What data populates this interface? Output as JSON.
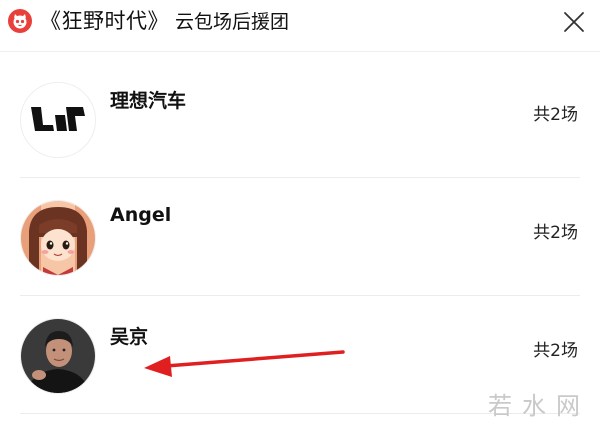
{
  "header": {
    "logo_icon": "maoyan-cat-icon",
    "film_title": "《狂野时代》",
    "subtitle": "云包场后援团",
    "close_icon": "close-icon"
  },
  "sponsors": [
    {
      "name": "理想汽车",
      "count": "共2场",
      "avatar": "li-auto-logo"
    },
    {
      "name": "Angel",
      "count": "共2场",
      "avatar": "cartoon-girl-avatar"
    },
    {
      "name": "吴京",
      "count": "共2场",
      "avatar": "person-photo-avatar"
    }
  ],
  "annotation": {
    "arrow_color": "#e02020",
    "arrow_direction": "left"
  },
  "watermark": "若水网",
  "colors": {
    "brand_red": "#e8403a",
    "text": "#111111",
    "divider": "#ececec"
  }
}
